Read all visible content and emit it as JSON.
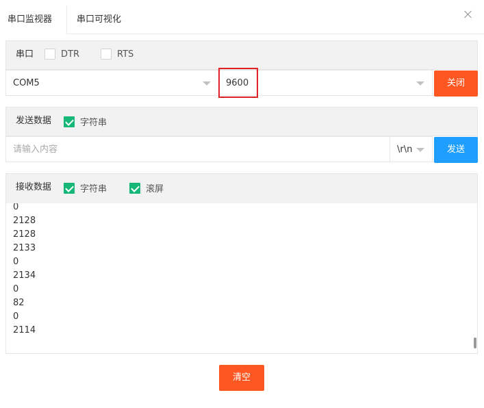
{
  "tabs": [
    "串口监视器",
    "串口可视化"
  ],
  "serial": {
    "title": "串口",
    "dtr_label": "DTR",
    "dtr_checked": false,
    "rts_label": "RTS",
    "rts_checked": false,
    "port": "COM5",
    "baud": "9600",
    "close_label": "关闭"
  },
  "send": {
    "title": "发送数据",
    "string_label": "字符串",
    "string_checked": true,
    "placeholder": "请输入内容",
    "line_ending": "\\r\\n",
    "send_label": "发送"
  },
  "receive": {
    "title": "接收数据",
    "string_label": "字符串",
    "string_checked": true,
    "scroll_label": "滚屏",
    "scroll_checked": true,
    "lines": [
      "0",
      "2128",
      "2128",
      "2133",
      "0",
      "2134",
      "0",
      "82",
      "0",
      "2114"
    ]
  },
  "clear_label": "清空",
  "colors": {
    "danger": "#ff5722",
    "primary": "#1e9fff",
    "check": "#16b777",
    "highlight_box": "#e02020"
  }
}
